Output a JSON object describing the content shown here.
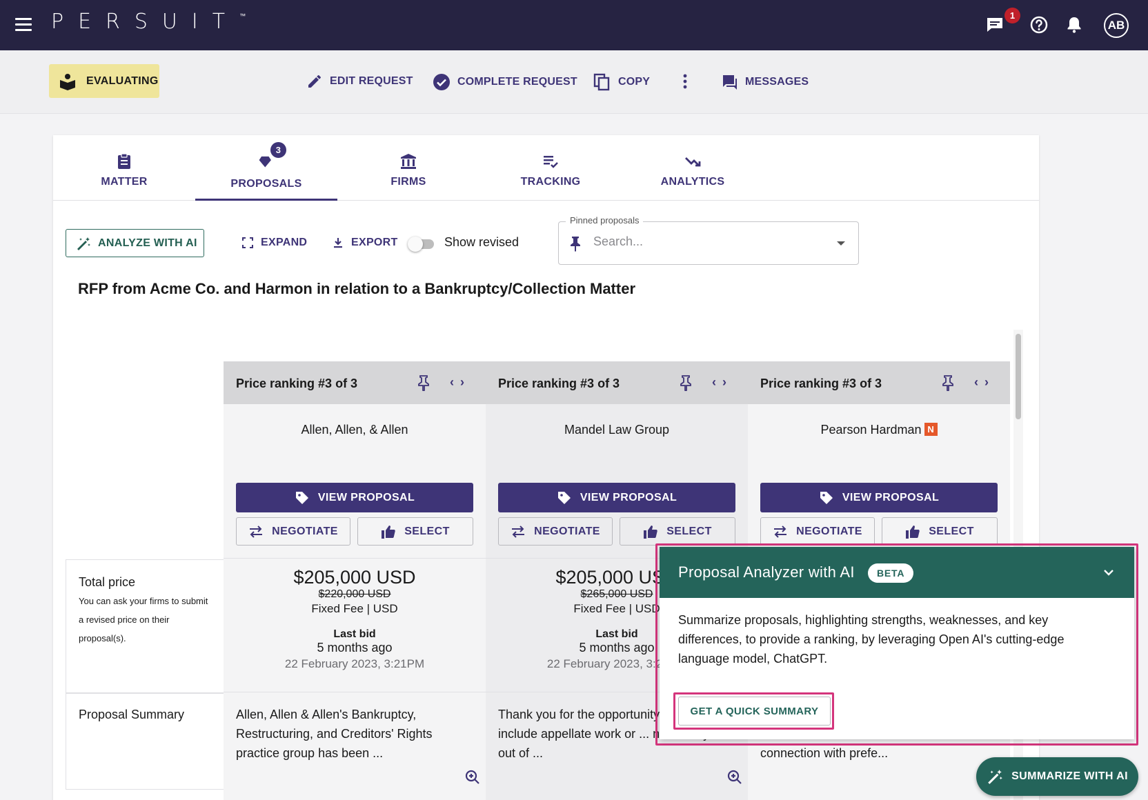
{
  "topbar": {
    "logo": "PERSUIT",
    "logo_tm": "™",
    "messages_badge": "1",
    "avatar_initials": "AB"
  },
  "actionbar": {
    "status": "EVALUATING",
    "edit": "EDIT REQUEST",
    "complete": "COMPLETE REQUEST",
    "copy": "COPY",
    "messages": "MESSAGES"
  },
  "tabs": [
    {
      "label": "MATTER"
    },
    {
      "label": "PROPOSALS",
      "badge": "3"
    },
    {
      "label": "FIRMS"
    },
    {
      "label": "TRACKING"
    },
    {
      "label": "ANALYTICS"
    }
  ],
  "toolbar": {
    "analyze": "ANALYZE WITH AI",
    "expand": "EXPAND",
    "export": "EXPORT",
    "show_revised": "Show revised",
    "pinned_label": "Pinned proposals",
    "pinned_placeholder": "Search..."
  },
  "rfp_title": "RFP from Acme Co. and Harmon in relation to a Bankruptcy/Collection Matter",
  "rows": {
    "total_price": "Total price",
    "total_price_help": "You can ask your firms to submit a revised price on their proposal(s).",
    "proposal_summary": "Proposal Summary"
  },
  "proposals": [
    {
      "rank": "Price ranking #3 of 3",
      "firm": "Allen, Allen, & Allen",
      "new_badge": "",
      "view": "VIEW PROPOSAL",
      "negotiate": "NEGOTIATE",
      "select": "SELECT",
      "price": "$205,000 USD",
      "old_price": "$220,000 USD",
      "fee_type": "Fixed Fee | USD",
      "last_bid": "Last bid",
      "ago": "5 months ago",
      "date": "22 February 2023, 3:21PM",
      "summary": "Allen, Allen & Allen's Bankruptcy, Restructuring, and Creditors' Rights practice group has been ..."
    },
    {
      "rank": "Price ranking #3 of 3",
      "firm": "Mandel Law Group",
      "new_badge": "",
      "view": "VIEW PROPOSAL",
      "negotiate": "NEGOTIATE",
      "select": "SELECT",
      "price": "$205,000 USD",
      "old_price": "$265,000 USD",
      "fee_type": "Fixed Fee | USD",
      "last_bid": "Last bid",
      "ago": "5 months ago",
      "date": "22 February 2023, 3:21PM",
      "summary": "Thank you for the opportunity ... not include appellate work or ... necessary out of ..."
    },
    {
      "rank": "Price ranking #3 of 3",
      "firm": "Pearson Hardman",
      "new_badge": "N",
      "view": "VIEW PROPOSAL",
      "negotiate": "NEGOTIATE",
      "select": "SELECT",
      "price": "",
      "old_price": "",
      "fee_type": "",
      "last_bid": "",
      "ago": "",
      "date": "",
      "summary": "connection with prefe..."
    }
  ],
  "ai_panel": {
    "title": "Proposal Analyzer with AI",
    "beta": "BETA",
    "body": "Summarize proposals, highlighting strengths, weaknesses, and key differences, to provide a ranking, by leveraging Open AI's cutting-edge language model, ChatGPT.",
    "quick_summary": "GET A QUICK SUMMARY"
  },
  "fab": "SUMMARIZE WITH AI",
  "colors": {
    "brand": "#262342",
    "accent": "#3e3477",
    "ai_green": "#24645a",
    "highlight": "#d4357c",
    "status_chip": "#efe59b"
  }
}
